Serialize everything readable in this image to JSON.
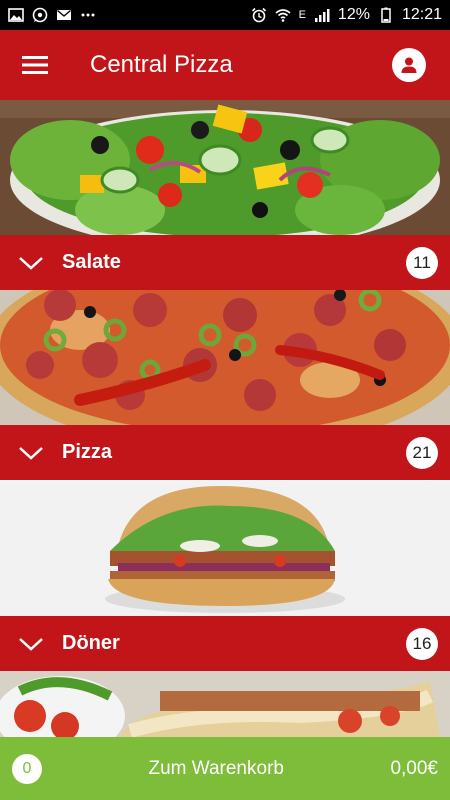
{
  "status_bar": {
    "battery_percent": "12%",
    "time": "12:21",
    "network_label": "E",
    "icons_left": [
      "gallery-icon",
      "whatsapp-icon",
      "email-icon",
      "more-dots-icon"
    ],
    "icons_right": [
      "alarm-icon",
      "wifi-icon",
      "signal-icon",
      "battery-icon"
    ]
  },
  "app_bar": {
    "title": "Central Pizza",
    "menu_icon": "hamburger-menu-icon",
    "account_icon": "user-account-icon",
    "color": "#c1151a"
  },
  "categories": [
    {
      "name": "Salate",
      "count": "11",
      "image": "salad-photo"
    },
    {
      "name": "Pizza",
      "count": "21",
      "image": "pizza-photo"
    },
    {
      "name": "Döner",
      "count": "16",
      "image": "doner-photo"
    },
    {
      "name": "",
      "count": "",
      "image": "lahmacun-photo"
    }
  ],
  "cart": {
    "count": "0",
    "label": "Zum Warenkorb",
    "total": "0,00€",
    "color": "#7dbd3a"
  }
}
